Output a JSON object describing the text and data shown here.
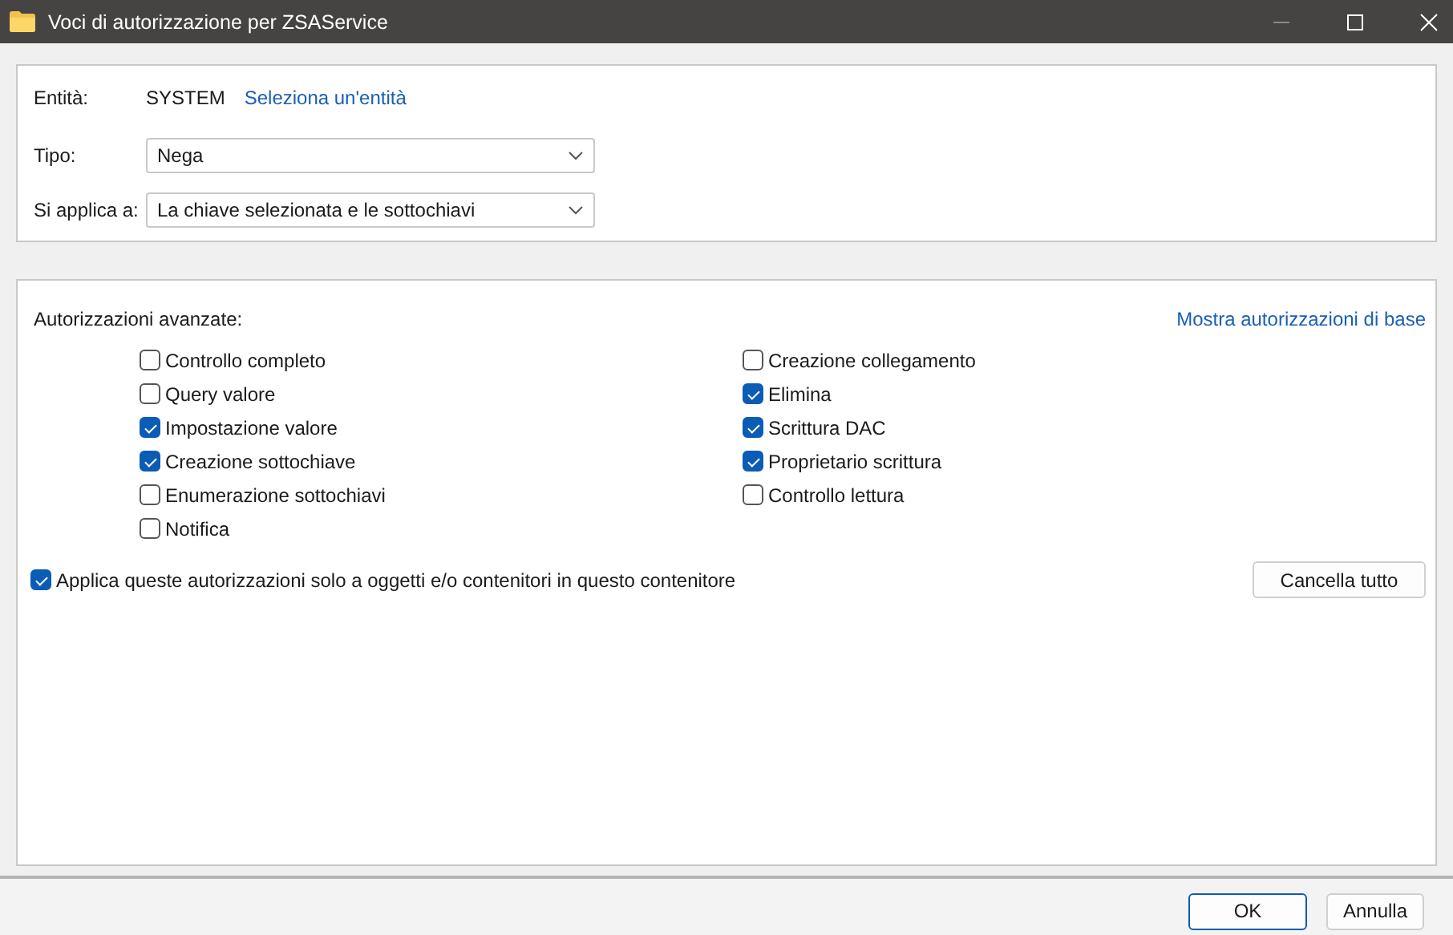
{
  "window": {
    "title": "Voci di autorizzazione per ZSAService"
  },
  "principal": {
    "label": "Entità:",
    "value": "SYSTEM",
    "link": "Seleziona un'entità"
  },
  "type": {
    "label": "Tipo:",
    "value": "Nega"
  },
  "applies_to": {
    "label": "Si applica a:",
    "value": "La chiave selezionata e le sottochiavi"
  },
  "advanced": {
    "label": "Autorizzazioni avanzate:",
    "link": "Mostra autorizzazioni di base",
    "columns": [
      {
        "permissions": [
          {
            "label": "Controllo completo",
            "checked": false
          },
          {
            "label": "Query valore",
            "checked": false
          },
          {
            "label": "Impostazione valore",
            "checked": true
          },
          {
            "label": "Creazione sottochiave",
            "checked": true
          },
          {
            "label": "Enumerazione sottochiavi",
            "checked": false
          },
          {
            "label": "Notifica",
            "checked": false
          }
        ]
      },
      {
        "permissions": [
          {
            "label": "Creazione collegamento",
            "checked": false
          },
          {
            "label": "Elimina",
            "checked": true
          },
          {
            "label": "Scrittura DAC",
            "checked": true
          },
          {
            "label": "Proprietario scrittura",
            "checked": true
          },
          {
            "label": "Controllo lettura",
            "checked": false
          }
        ]
      }
    ]
  },
  "apply_only": {
    "label": "Applica queste autorizzazioni solo a oggetti e/o contenitori in questo contenitore",
    "checked": true
  },
  "clear_button": "Cancella tutto",
  "buttons": [
    {
      "label": "OK",
      "default": true
    },
    {
      "label": "Annulla",
      "default": false
    }
  ]
}
